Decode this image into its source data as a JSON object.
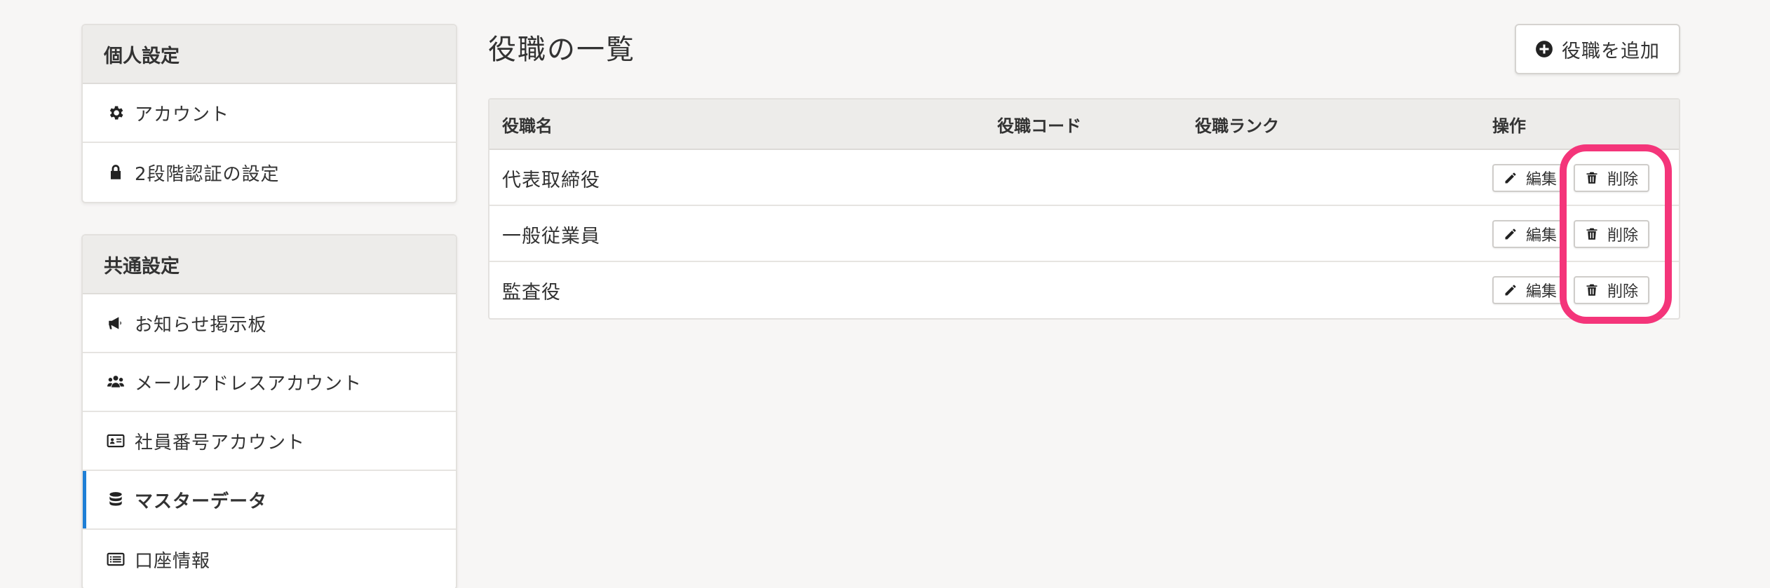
{
  "sidebar": {
    "personal": {
      "title": "個人設定",
      "items": [
        {
          "label": "アカウント",
          "icon": "gear-icon"
        },
        {
          "label": "2段階認証の設定",
          "icon": "lock-icon"
        }
      ]
    },
    "common": {
      "title": "共通設定",
      "items": [
        {
          "label": "お知らせ掲示板",
          "icon": "megaphone-icon"
        },
        {
          "label": "メールアドレスアカウント",
          "icon": "users-icon"
        },
        {
          "label": "社員番号アカウント",
          "icon": "id-card-icon"
        },
        {
          "label": "マスターデータ",
          "icon": "database-icon",
          "active": true
        },
        {
          "label": "口座情報",
          "icon": "list-card-icon"
        }
      ]
    }
  },
  "main": {
    "title": "役職の一覧",
    "add_button": "役職を追加",
    "table": {
      "headers": [
        "役職名",
        "役職コード",
        "役職ランク",
        "操作"
      ],
      "rows": [
        {
          "name": "代表取締役",
          "code": "",
          "rank": ""
        },
        {
          "name": "一般従業員",
          "code": "",
          "rank": ""
        },
        {
          "name": "監査役",
          "code": "",
          "rank": ""
        }
      ],
      "edit_label": "編集",
      "delete_label": "削除"
    }
  },
  "colors": {
    "accent": "#1f7fd6",
    "highlight": "#f4357a",
    "background": "#f7f6f5"
  }
}
